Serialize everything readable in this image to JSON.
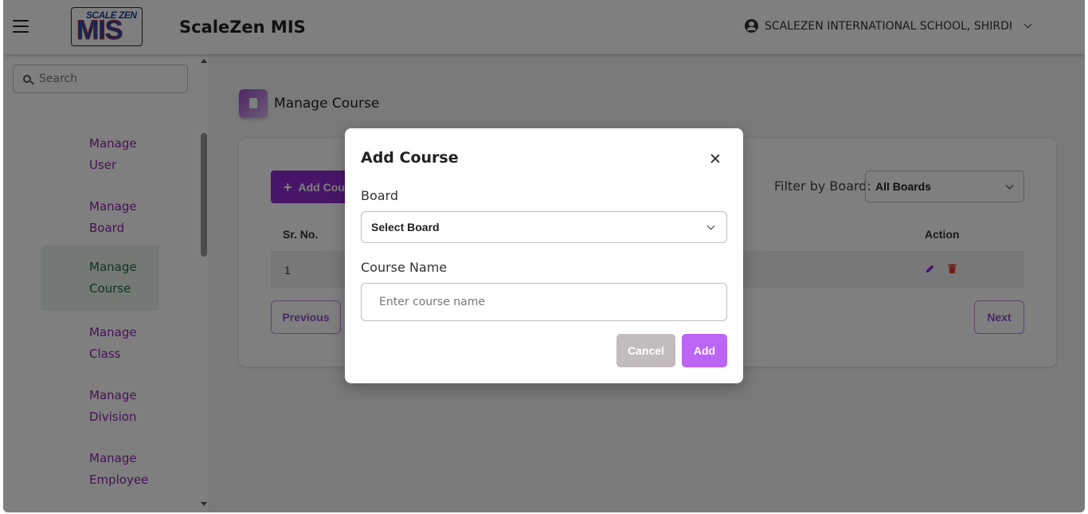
{
  "header": {
    "logo_top": "SCALE ZEN",
    "logo_main": "MIS",
    "app_title": "ScaleZen MIS",
    "school_name": "SCALEZEN INTERNATIONAL SCHOOL, SHIRDI"
  },
  "sidebar": {
    "search_placeholder": "Search",
    "items": [
      {
        "line1": "Manage",
        "line2": "User",
        "active": false
      },
      {
        "line1": "Manage",
        "line2": "Board",
        "active": false
      },
      {
        "line1": "Manage",
        "line2": "Course",
        "active": true
      },
      {
        "line1": "Manage",
        "line2": "Class",
        "active": false
      },
      {
        "line1": "Manage",
        "line2": "Division",
        "active": false
      },
      {
        "line1": "Manage",
        "line2": "Employee",
        "active": false
      }
    ]
  },
  "main": {
    "page_title": "Manage Course",
    "add_button": "Add Cou",
    "filter_label": "Filter by Board:",
    "filter_value": "All Boards",
    "columns": {
      "sr": "Sr. No.",
      "action": "Action"
    },
    "rows": [
      {
        "sr": "1"
      }
    ],
    "prev_label": "Previous",
    "next_label": "Next"
  },
  "modal": {
    "title": "Add Course",
    "board_label": "Board",
    "board_select": "Select Board",
    "course_label": "Course Name",
    "course_placeholder": "Enter course name",
    "cancel_label": "Cancel",
    "add_label": "Add"
  },
  "colors": {
    "accent": "#8e2dd3",
    "nav_text": "#8e24aa",
    "active_nav_bg": "#e8f3ea",
    "active_nav_text": "#1f6b3a",
    "modal_add": "#bc65f5",
    "modal_cancel": "#c3bcbc"
  }
}
